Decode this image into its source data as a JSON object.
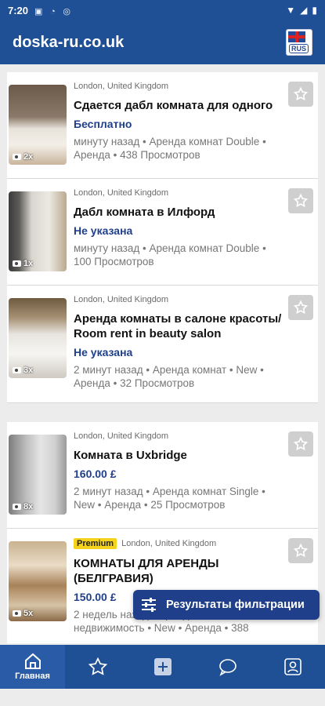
{
  "status_bar": {
    "time": "7:20"
  },
  "app_bar": {
    "title": "doska-ru.co.uk",
    "language": "RUS"
  },
  "listings": [
    {
      "location": "London, United Kingdom",
      "title": "Сдается дабл комната для одного",
      "price": "Бесплатно",
      "meta": "минуту назад • Аренда комнат Double • Аренда • 438 Просмотров",
      "photo_count": "2x",
      "premium": ""
    },
    {
      "location": "London, United Kingdom",
      "title": "Дабл комната в Илфорд",
      "price": "Не указана",
      "meta": "минуту назад • Аренда комнат Double • 100 Просмотров",
      "photo_count": "1x",
      "premium": ""
    },
    {
      "location": "London, United Kingdom",
      "title": "Аренда комнаты в салоне красоты/ Room rent in beauty salon",
      "price": "Не указана",
      "meta": "2 минут назад • Аренда комнат • New • Аренда • 32 Просмотров",
      "photo_count": "3x",
      "premium": ""
    },
    {
      "location": "London, United Kingdom",
      "title": "Комната в Uxbridge",
      "price": "160.00 £",
      "meta": "2 минут назад • Аренда комнат Single • New • Аренда • 25 Просмотров",
      "photo_count": "8x",
      "premium": ""
    },
    {
      "location": "London, United Kingdom",
      "title": "КОМНАТЫ ДЛЯ АРЕНДЫ (БЕЛГРАВИЯ)",
      "price": "150.00 £",
      "meta": "2 недель назад • Аренда комнат • недвижимость • New • Аренда • 388",
      "photo_count": "5x",
      "premium": "Premium"
    }
  ],
  "filter_button": {
    "label": "Результаты фильтрации"
  },
  "bottom_nav": {
    "home_label": "Главная"
  },
  "colors": {
    "primary": "#1f4f94",
    "price": "#1f3f8a",
    "premium": "#f5d31a"
  }
}
